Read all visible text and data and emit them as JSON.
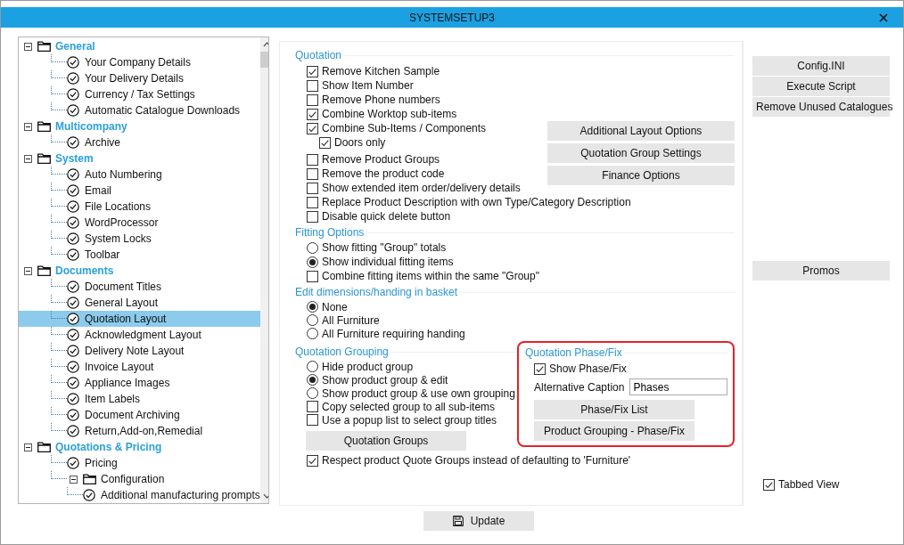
{
  "window": {
    "title": "SYSTEMSETUP3"
  },
  "tree": [
    {
      "kind": "group",
      "label": "General",
      "expanded": true,
      "children": [
        {
          "kind": "item",
          "label": "Your Company Details",
          "selected": false
        },
        {
          "kind": "item",
          "label": "Your Delivery Details",
          "selected": false
        },
        {
          "kind": "item",
          "label": "Currency / Tax Settings",
          "selected": false
        },
        {
          "kind": "item",
          "label": "Automatic Catalogue Downloads",
          "selected": false
        }
      ]
    },
    {
      "kind": "group",
      "label": "Multicompany",
      "expanded": true,
      "children": [
        {
          "kind": "item",
          "label": "Archive",
          "selected": false
        }
      ]
    },
    {
      "kind": "group",
      "label": "System",
      "expanded": true,
      "children": [
        {
          "kind": "item",
          "label": "Auto Numbering",
          "selected": false
        },
        {
          "kind": "item",
          "label": "Email",
          "selected": false
        },
        {
          "kind": "item",
          "label": "File Locations",
          "selected": false
        },
        {
          "kind": "item",
          "label": "WordProcessor",
          "selected": false
        },
        {
          "kind": "item",
          "label": "System Locks",
          "selected": false
        },
        {
          "kind": "item",
          "label": "Toolbar",
          "selected": false
        }
      ]
    },
    {
      "kind": "group",
      "label": "Documents",
      "expanded": true,
      "children": [
        {
          "kind": "item",
          "label": "Document Titles",
          "selected": false
        },
        {
          "kind": "item",
          "label": "General Layout",
          "selected": false
        },
        {
          "kind": "item",
          "label": "Quotation Layout",
          "selected": true
        },
        {
          "kind": "item",
          "label": "Acknowledgment Layout",
          "selected": false
        },
        {
          "kind": "item",
          "label": "Delivery Note Layout",
          "selected": false
        },
        {
          "kind": "item",
          "label": "Invoice Layout",
          "selected": false
        },
        {
          "kind": "item",
          "label": "Appliance Images",
          "selected": false
        },
        {
          "kind": "item",
          "label": "Item Labels",
          "selected": false
        },
        {
          "kind": "item",
          "label": "Document Archiving",
          "selected": false
        },
        {
          "kind": "item",
          "label": "Return,Add-on,Remedial",
          "selected": false
        }
      ]
    },
    {
      "kind": "group",
      "label": "Quotations & Pricing",
      "expanded": true,
      "children": [
        {
          "kind": "item",
          "label": "Pricing",
          "selected": false
        },
        {
          "kind": "folder",
          "label": "Configuration",
          "expanded": true,
          "children": [
            {
              "kind": "item",
              "label": "Additional manufacturing prompts",
              "selected": false
            }
          ]
        }
      ]
    }
  ],
  "quotation": {
    "title": "Quotation",
    "options": [
      {
        "kind": "checkbox",
        "label": "Remove Kitchen Sample",
        "checked": true
      },
      {
        "kind": "checkbox",
        "label": "Show Item Number",
        "checked": false
      },
      {
        "kind": "checkbox",
        "label": "Remove Phone numbers",
        "checked": false
      },
      {
        "kind": "checkbox",
        "label": "Combine Worktop sub-items",
        "checked": true
      },
      {
        "kind": "checkbox",
        "label": "Combine Sub-Items / Components",
        "checked": true,
        "children": [
          {
            "kind": "checkbox",
            "label": "Doors only",
            "checked": true
          }
        ]
      },
      {
        "kind": "checkbox",
        "label": "Remove Product Groups",
        "checked": false
      },
      {
        "kind": "checkbox",
        "label": "Remove the product code",
        "checked": false
      },
      {
        "kind": "checkbox",
        "label": "Show extended item order/delivery details",
        "checked": false
      },
      {
        "kind": "checkbox",
        "label": "Replace Product Description with own Type/Category Description",
        "checked": false
      },
      {
        "kind": "checkbox",
        "label": "Disable quick delete button",
        "checked": false
      }
    ],
    "buttons": [
      "Additional Layout Options",
      "Quotation Group Settings",
      "Finance Options"
    ]
  },
  "fitting_options": {
    "title": "Fitting Options",
    "options": [
      {
        "kind": "radio",
        "label": "Show fitting \"Group\" totals",
        "selected": false
      },
      {
        "kind": "radio",
        "label": "Show individual fitting items",
        "selected": true
      },
      {
        "kind": "checkbox",
        "label": "Combine fitting items within the same \"Group\"",
        "checked": false
      }
    ]
  },
  "edit_dimensions": {
    "title": "Edit dimensions/handing in basket",
    "options": [
      {
        "kind": "radio",
        "label": "None",
        "selected": true
      },
      {
        "kind": "radio",
        "label": "All Furniture",
        "selected": false
      },
      {
        "kind": "radio",
        "label": "All Furniture requiring handing",
        "selected": false
      }
    ]
  },
  "quotation_grouping": {
    "title": "Quotation Grouping",
    "options": [
      {
        "kind": "radio",
        "label": "Hide product group",
        "selected": false
      },
      {
        "kind": "radio",
        "label": "Show product group & edit",
        "selected": true
      },
      {
        "kind": "radio",
        "label": "Show product group & use own grouping",
        "selected": false
      },
      {
        "kind": "checkbox",
        "label": "Copy selected group to all sub-items",
        "checked": false
      },
      {
        "kind": "checkbox",
        "label": "Use a popup list to select group titles",
        "checked": false
      }
    ],
    "button": "Quotation Groups"
  },
  "phase_fix": {
    "title": "Quotation Phase/Fix",
    "show": {
      "label": "Show Phase/Fix",
      "checked": true
    },
    "caption": {
      "label": "Alternative Caption",
      "value": "Phases"
    },
    "buttons": [
      "Phase/Fix List",
      "Product Grouping - Phase/Fix"
    ]
  },
  "respect": {
    "label": "Respect product Quote Groups instead of defaulting to 'Furniture'",
    "checked": true
  },
  "side_buttons": [
    "Config.INI",
    "Execute Script",
    "Remove Unused Catalogues"
  ],
  "promos_button": "Promos",
  "tabbed_view": {
    "label": "Tabbed View",
    "checked": true
  },
  "update_button": "Update"
}
